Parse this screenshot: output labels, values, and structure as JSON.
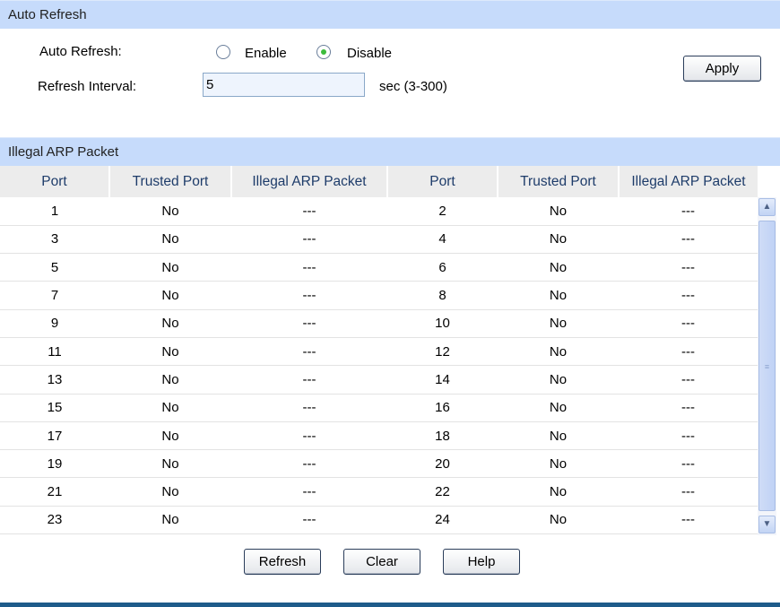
{
  "auto_refresh": {
    "title": "Auto Refresh",
    "auto_refresh_label": "Auto Refresh:",
    "enable_label": "Enable",
    "disable_label": "Disable",
    "selected": "Disable",
    "interval_label": "Refresh Interval:",
    "interval_value": "5",
    "interval_hint": "sec (3-300)",
    "apply_label": "Apply"
  },
  "arp": {
    "title": "Illegal ARP Packet",
    "headers": [
      "Port",
      "Trusted Port",
      "Illegal ARP Packet",
      "Port",
      "Trusted Port",
      "Illegal ARP Packet"
    ],
    "rows": [
      [
        "1",
        "No",
        "---",
        "2",
        "No",
        "---"
      ],
      [
        "3",
        "No",
        "---",
        "4",
        "No",
        "---"
      ],
      [
        "5",
        "No",
        "---",
        "6",
        "No",
        "---"
      ],
      [
        "7",
        "No",
        "---",
        "8",
        "No",
        "---"
      ],
      [
        "9",
        "No",
        "---",
        "10",
        "No",
        "---"
      ],
      [
        "11",
        "No",
        "---",
        "12",
        "No",
        "---"
      ],
      [
        "13",
        "No",
        "---",
        "14",
        "No",
        "---"
      ],
      [
        "15",
        "No",
        "---",
        "16",
        "No",
        "---"
      ],
      [
        "17",
        "No",
        "---",
        "18",
        "No",
        "---"
      ],
      [
        "19",
        "No",
        "---",
        "20",
        "No",
        "---"
      ],
      [
        "21",
        "No",
        "---",
        "22",
        "No",
        "---"
      ],
      [
        "23",
        "No",
        "---",
        "24",
        "No",
        "---"
      ]
    ]
  },
  "buttons": {
    "refresh": "Refresh",
    "clear": "Clear",
    "help": "Help"
  }
}
